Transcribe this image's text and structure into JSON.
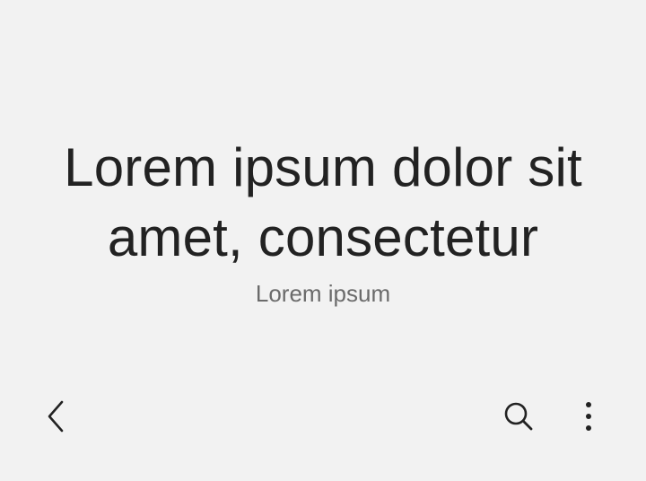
{
  "header": {
    "title": "Lorem ipsum dolor sit amet, consectetur",
    "subtitle": "Lorem ipsum"
  },
  "toolbar": {
    "back_icon": "chevron-left-icon",
    "search_icon": "search-icon",
    "more_icon": "more-vert-icon"
  },
  "colors": {
    "background": "#f2f2f2",
    "title_text": "#222222",
    "subtitle_text": "#6b6b6b",
    "icon": "#222222"
  }
}
